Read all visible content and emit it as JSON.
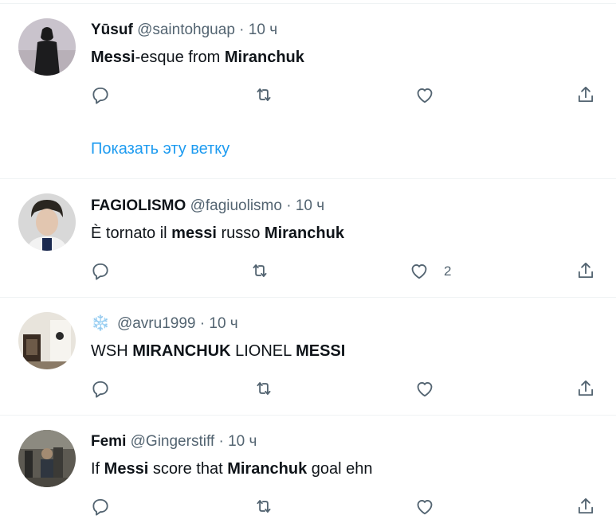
{
  "tweets": [
    {
      "name": "Yūsuf",
      "handle": "@saintohguap",
      "separator": "·",
      "time": "10 ч",
      "text_parts": [
        {
          "t": "Messi",
          "bold": true
        },
        {
          "t": "-esque from ",
          "bold": false
        },
        {
          "t": "Miranchuk",
          "bold": true
        }
      ],
      "like_count": ""
    },
    {
      "name": "FAGIOLISMO",
      "handle": "@fagiuolismo",
      "separator": "·",
      "time": "10 ч",
      "text_parts": [
        {
          "t": "È tornato il ",
          "bold": false
        },
        {
          "t": "messi",
          "bold": true
        },
        {
          "t": " russo ",
          "bold": false
        },
        {
          "t": "Miranchuk",
          "bold": true
        }
      ],
      "like_count": "2"
    },
    {
      "name": "❄️",
      "handle": "@avru1999",
      "separator": "·",
      "time": "10 ч",
      "text_parts": [
        {
          "t": "WSH ",
          "bold": false
        },
        {
          "t": "MIRANCHUK",
          "bold": true
        },
        {
          "t": " LIONEL ",
          "bold": false
        },
        {
          "t": "MESSI",
          "bold": true
        }
      ],
      "like_count": ""
    },
    {
      "name": "Femi",
      "handle": "@Gingerstiff",
      "separator": "·",
      "time": "10 ч",
      "text_parts": [
        {
          "t": "If ",
          "bold": false
        },
        {
          "t": "Messi",
          "bold": true
        },
        {
          "t": " score that ",
          "bold": false
        },
        {
          "t": "Miranchuk",
          "bold": true
        },
        {
          "t": " goal ehn",
          "bold": false
        }
      ],
      "like_count": ""
    }
  ],
  "show_thread_label": "Показать эту ветку",
  "icons": {
    "reply": "reply-icon",
    "retweet": "retweet-icon",
    "like": "like-icon",
    "share": "share-icon"
  },
  "colors": {
    "link": "#1d9bf0",
    "secondary_text": "#536471",
    "divider": "#eff3f4"
  }
}
